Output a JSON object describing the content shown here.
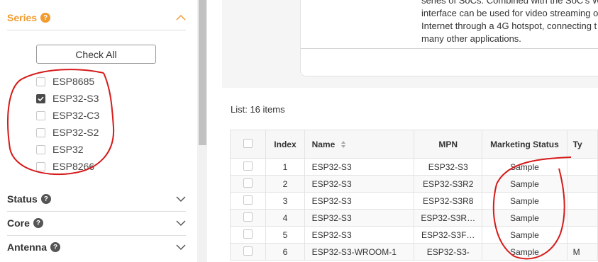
{
  "sidebar": {
    "series": {
      "title": "Series",
      "help": "?",
      "check_all_label": "Check All",
      "items": [
        {
          "label": "ESP8685",
          "checked": false
        },
        {
          "label": "ESP32-S3",
          "checked": true
        },
        {
          "label": "ESP32-C3",
          "checked": false
        },
        {
          "label": "ESP32-S2",
          "checked": false
        },
        {
          "label": "ESP32",
          "checked": false
        },
        {
          "label": "ESP8266",
          "checked": false
        }
      ]
    },
    "filters": [
      {
        "title": "Status",
        "help": "?"
      },
      {
        "title": "Core",
        "help": "?"
      },
      {
        "title": "Antenna",
        "help": "?"
      }
    ],
    "accent_color": "#f29a2e"
  },
  "description": {
    "lines": [
      "series of SoCs. Combined with the SoC's W",
      "interface can be used for video streaming o",
      "Internet through a 4G hotspot, connecting t",
      "many other applications."
    ]
  },
  "list": {
    "count_label": "List: 16 items",
    "columns": [
      "",
      "Index",
      "Name",
      "MPN",
      "Marketing Status",
      "Ty"
    ],
    "rows": [
      {
        "index": "1",
        "name": "ESP32-S3",
        "mpn": "ESP32-S3",
        "status": "Sample",
        "type": ""
      },
      {
        "index": "2",
        "name": "ESP32-S3",
        "mpn": "ESP32-S3R2",
        "status": "Sample",
        "type": ""
      },
      {
        "index": "3",
        "name": "ESP32-S3",
        "mpn": "ESP32-S3R8",
        "status": "Sample",
        "type": ""
      },
      {
        "index": "4",
        "name": "ESP32-S3",
        "mpn": "ESP32-S3R…",
        "status": "Sample",
        "type": ""
      },
      {
        "index": "5",
        "name": "ESP32-S3",
        "mpn": "ESP32-S3F…",
        "status": "Sample",
        "type": ""
      },
      {
        "index": "6",
        "name": "ESP32-S3-WROOM-1",
        "mpn": "ESP32-S3-",
        "status": "Sample",
        "type": "M"
      }
    ]
  },
  "annotation_color": "#d61a1a"
}
